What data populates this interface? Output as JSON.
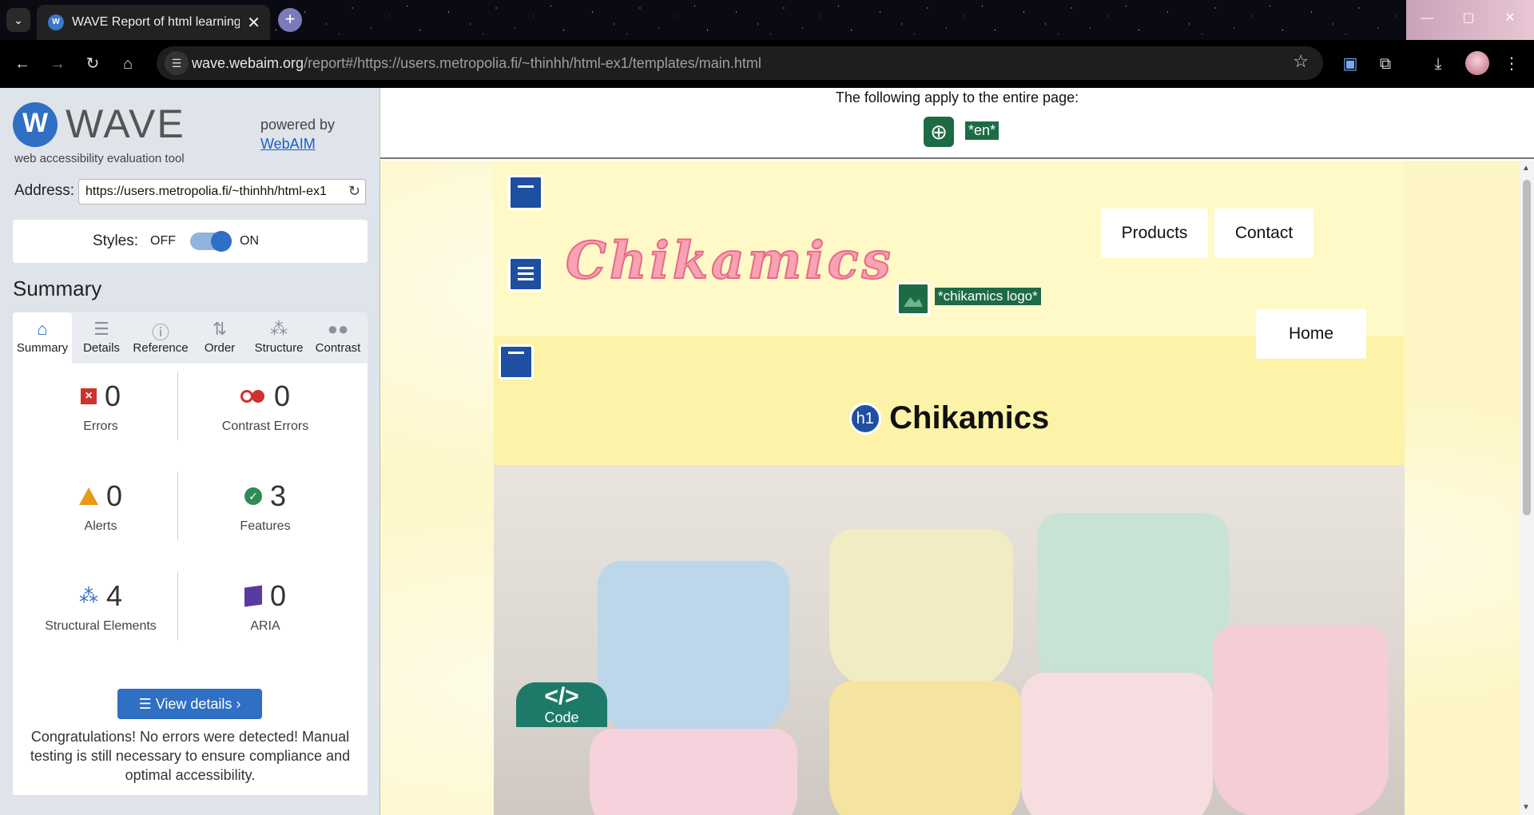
{
  "browser": {
    "tab_title": "WAVE Report of html learning",
    "tab_close": "✕",
    "new_tab": "+",
    "url_host": "wave.webaim.org",
    "url_path": "/report#/https://users.metropolia.fi/~thinhh/html-ex1/templates/main.html"
  },
  "sidebar": {
    "logo_letter": "W",
    "title": "WAVE",
    "tagline": "web accessibility evaluation tool",
    "powered_by": "powered by",
    "webaim_link": "WebAIM",
    "address_label": "Address:",
    "address_value": "https://users.metropolia.fi/~thinhh/html-ex1",
    "styles_label": "Styles:",
    "styles_off": "OFF",
    "styles_on": "ON",
    "styles_enabled": true,
    "summary_heading": "Summary",
    "tabs": [
      {
        "label": "Summary",
        "icon": "home-icon",
        "active": true
      },
      {
        "label": "Details",
        "icon": "list-icon",
        "active": false
      },
      {
        "label": "Reference",
        "icon": "info-icon",
        "active": false
      },
      {
        "label": "Order",
        "icon": "order-icon",
        "active": false
      },
      {
        "label": "Structure",
        "icon": "structure-icon",
        "active": false
      },
      {
        "label": "Contrast",
        "icon": "contrast-icon",
        "active": false
      }
    ],
    "stats": {
      "errors": {
        "value": "0",
        "label": "Errors"
      },
      "contrast_errors": {
        "value": "0",
        "label": "Contrast Errors"
      },
      "alerts": {
        "value": "0",
        "label": "Alerts"
      },
      "features": {
        "value": "3",
        "label": "Features"
      },
      "structural": {
        "value": "4",
        "label": "Structural Elements"
      },
      "aria": {
        "value": "0",
        "label": "ARIA"
      }
    },
    "view_details": "View details ›",
    "congrats": "Congratulations! No errors were detected! Manual testing is still necessary to ensure compliance and optimal accessibility."
  },
  "report": {
    "page_banner": "The following apply to the entire page:",
    "lang_label": "*en*",
    "img_label": "*chikamics logo*",
    "logo_text": "Chikamics",
    "nav": {
      "products": "Products",
      "contact": "Contact",
      "home": "Home"
    },
    "h1_badge": "h1",
    "h1_text": "Chikamics",
    "code_tab_icon": "</>",
    "code_tab_label": "Code"
  },
  "colors": {
    "wave_blue": "#2f6fc4",
    "error_red": "#d0312d",
    "feature_green": "#2e8b57",
    "alert_orange": "#e69a1a",
    "aria_purple": "#5a3aa0",
    "wave_green_label": "#1d6b45",
    "site_yellow": "#fdf3a8"
  }
}
